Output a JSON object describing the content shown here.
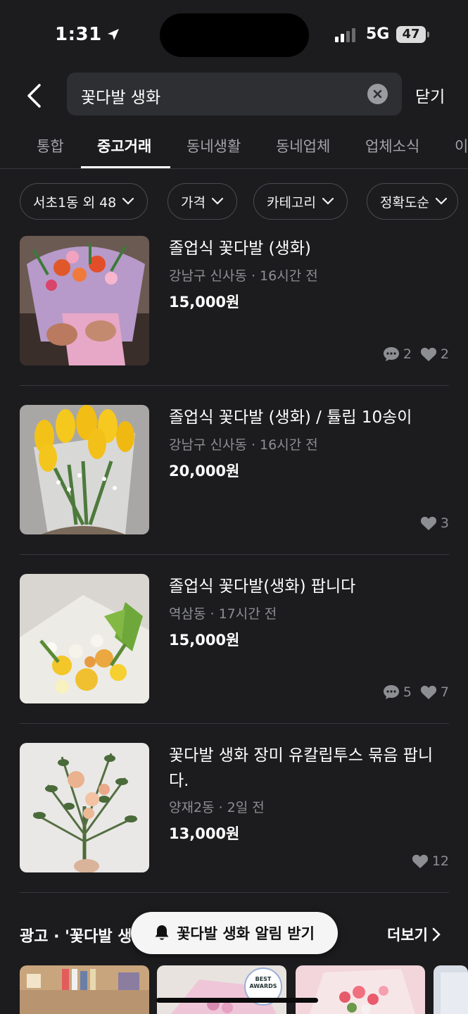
{
  "status_bar": {
    "time": "1:31",
    "network": "5G",
    "battery": "47"
  },
  "search": {
    "query": "꽃다발 생화",
    "close_label": "닫기"
  },
  "tabs": [
    "통합",
    "중고거래",
    "동네생활",
    "동네업체",
    "업체소식",
    "이"
  ],
  "active_tab": "중고거래",
  "filters": [
    "서초1동 외 48",
    "가격",
    "카테고리",
    "정확도순"
  ],
  "listings": [
    {
      "title": "졸업식 꽃다발 (생화)",
      "location": "강남구 신사동",
      "time": "16시간 전",
      "price": "15,000원",
      "chats": "2",
      "likes": "2"
    },
    {
      "title": "졸업식 꽃다발 (생화) / 튤립 10송이",
      "location": "강남구 신사동",
      "time": "16시간 전",
      "price": "20,000원",
      "likes": "3"
    },
    {
      "title": "졸업식 꽃다발(생화) 팝니다",
      "location": "역삼동",
      "time": "17시간 전",
      "price": "15,000원",
      "chats": "5",
      "likes": "7"
    },
    {
      "title": "꽃다발 생화 장미 유칼립투스 묶음 팝니다.",
      "location": "양재2동",
      "time": "2일 전",
      "price": "13,000원",
      "likes": "12"
    }
  ],
  "ad_section": {
    "label": "광고 · '꽃다발 생",
    "more_label": "더보기",
    "alert_label": "꽃다발 생화 알림 받기",
    "badge_line1": "BEST",
    "badge_line2": "AWARDS"
  },
  "colors": {
    "background": "#1c1c1e",
    "text_secondary": "#8d8e93",
    "divider": "#38393d"
  }
}
